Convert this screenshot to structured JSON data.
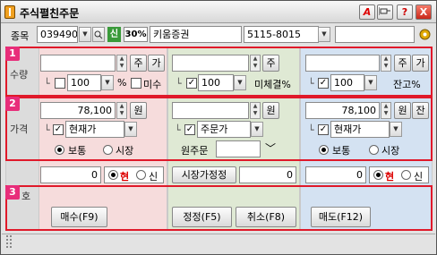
{
  "window": {
    "title": "주식펼친주문",
    "icons": [
      "letter-a-icon",
      "pin-icon",
      "help-icon",
      "close-icon"
    ],
    "help_label": "?",
    "close_label": "X",
    "a_label": "A"
  },
  "top": {
    "code_label": "종목",
    "code": "039490",
    "credit": "신",
    "margin": "30%",
    "name": "키움증권",
    "account": "5115-8015",
    "password": "",
    "gear": "gear-icon"
  },
  "sections": {
    "n1": "1",
    "n2": "2",
    "n3": "3",
    "qty": "수량",
    "price": "가격",
    "hogi": "호"
  },
  "left": {
    "qty": "",
    "ju": "주",
    "ga": "가",
    "rate": "100",
    "pct": "%",
    "misu": "미수",
    "price": "78,100",
    "won": "원",
    "ptype": "현재가",
    "normal": "보통",
    "market": "시장",
    "cnt": "0",
    "hyun": "현",
    "shin": "신",
    "order_button": "매수(F9)",
    "colors": {
      "bg": "#f6dcdc"
    }
  },
  "mid": {
    "qty": "",
    "ju": "주",
    "rate": "100",
    "unfilled": "미체결%",
    "price": "",
    "won": "원",
    "ptype": "주문가",
    "orig": "원주문",
    "orig_value": "",
    "mprice": "시장가정정",
    "cnt": "0",
    "modify": "정정(F5)",
    "cancel": "취소(F8)",
    "colors": {
      "bg": "#dfe9d4"
    }
  },
  "right": {
    "qty": "",
    "ju": "주",
    "ga": "가",
    "rate": "100",
    "balance": "잔고%",
    "price": "78,100",
    "won": "원",
    "jan": "잔",
    "ptype": "현재가",
    "normal": "보통",
    "market": "시장",
    "cnt": "0",
    "hyun": "현",
    "shin": "신",
    "order_button": "매도(F12)",
    "colors": {
      "bg": "#d4e2f2"
    }
  }
}
